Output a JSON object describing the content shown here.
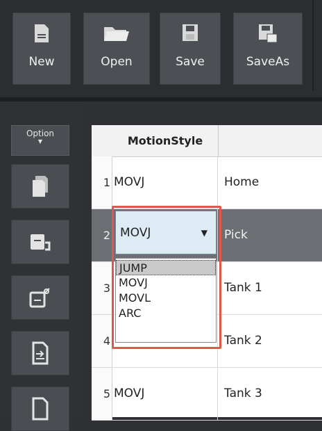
{
  "toolbar": {
    "buttons": [
      {
        "label": "New",
        "icon": "new-file-icon"
      },
      {
        "label": "Open",
        "icon": "folder-open-icon"
      },
      {
        "label": "Save",
        "icon": "save-icon"
      },
      {
        "label": "SaveAs",
        "icon": "save-as-icon"
      }
    ]
  },
  "side": {
    "option_label": "Option",
    "buttons": [
      {
        "icon": "copy-icon"
      },
      {
        "icon": "paste-icon"
      },
      {
        "icon": "cut-icon"
      },
      {
        "icon": "insert-icon"
      },
      {
        "icon": "delete-icon"
      }
    ]
  },
  "grid": {
    "header": {
      "motion_style": "MotionStyle",
      "name": ""
    },
    "rows": [
      {
        "num": "1",
        "motion": "MOVJ",
        "name": "Home"
      },
      {
        "num": "2",
        "motion": "MOVJ",
        "name": "Pick"
      },
      {
        "num": "3",
        "motion": "",
        "name": "Tank 1"
      },
      {
        "num": "4",
        "motion": "",
        "name": "Tank 2"
      },
      {
        "num": "5",
        "motion": "MOVJ",
        "name": "Tank 3"
      }
    ]
  },
  "combo": {
    "value": "MOVJ",
    "options": [
      "JUMP",
      "MOVJ",
      "MOVL",
      "ARC"
    ],
    "highlighted": "JUMP"
  },
  "colors": {
    "highlight_box": "#e2574c",
    "selected_row": "#6b6e72",
    "combo_bg": "#ddebf5"
  }
}
